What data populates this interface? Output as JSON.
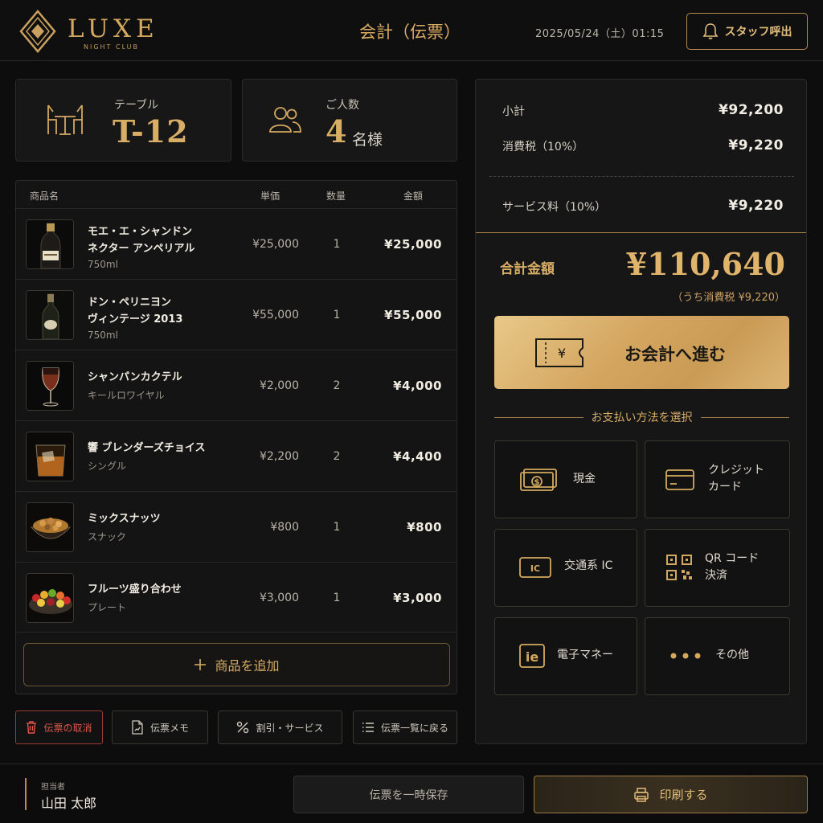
{
  "header": {
    "brand": "LUXE",
    "brand_sub": "NIGHT CLUB",
    "title": "会計（伝票）",
    "datetime": "2025/05/24（土）01:15",
    "staff_call": "スタッフ呼出"
  },
  "table": {
    "label": "テーブル",
    "value": "T-12"
  },
  "guests": {
    "label": "ご人数",
    "count": "4",
    "unit": "名様"
  },
  "order": {
    "columns": {
      "name": "商品名",
      "unit_price": "単価",
      "qty": "数量",
      "amount": "金額"
    },
    "items": [
      {
        "name1": "モエ・エ・シャンドン",
        "name2": "ネクター アンペリアル",
        "sub": "750ml",
        "unit_price": "¥25,000",
        "qty": "1",
        "amount": "¥25,000"
      },
      {
        "name1": "ドン・ペリニヨン",
        "name2": "ヴィンテージ 2013",
        "sub": "750ml",
        "unit_price": "¥55,000",
        "qty": "1",
        "amount": "¥55,000"
      },
      {
        "name1": "シャンパンカクテル",
        "name2": "",
        "sub": "キールロワイヤル",
        "unit_price": "¥2,000",
        "qty": "2",
        "amount": "¥4,000"
      },
      {
        "name1": "響 ブレンダーズチョイス",
        "name2": "",
        "sub": "シングル",
        "unit_price": "¥2,200",
        "qty": "2",
        "amount": "¥4,400"
      },
      {
        "name1": "ミックスナッツ",
        "name2": "",
        "sub": "スナック",
        "unit_price": "¥800",
        "qty": "1",
        "amount": "¥800"
      },
      {
        "name1": "フルーツ盛り合わせ",
        "name2": "",
        "sub": "プレート",
        "unit_price": "¥3,000",
        "qty": "1",
        "amount": "¥3,000"
      }
    ],
    "add_label": "商品を追加"
  },
  "actions": {
    "cancel": "伝票の取消",
    "memo": "伝票メモ",
    "discount": "割引・サービス",
    "back_list": "伝票一覧に戻る"
  },
  "summary": {
    "subtotal_label": "小計",
    "subtotal": "¥92,200",
    "tax_label": "消費税（10%）",
    "tax": "¥9,220",
    "service_label": "サービス料（10%）",
    "service": "¥9,220",
    "total_label": "合計金額",
    "total": "¥110,640",
    "tax_note": "（うち消費税 ¥9,220）",
    "checkout": "お会計へ進む"
  },
  "payment": {
    "heading": "お支払い方法を選択",
    "methods": {
      "cash": "現金",
      "credit1": "クレジット",
      "credit2": "カード",
      "ic": "交通系 IC",
      "qr1": "QR コード",
      "qr2": "決済",
      "emoney": "電子マネー",
      "other": "その他"
    }
  },
  "footer": {
    "staff_caption": "担当者",
    "staff_name": "山田 太郎",
    "save": "伝票を一時保存",
    "print": "印刷する"
  },
  "colors": {
    "gold": "#d4a95f",
    "background": "#0d0d0e",
    "danger": "#e0574b"
  }
}
